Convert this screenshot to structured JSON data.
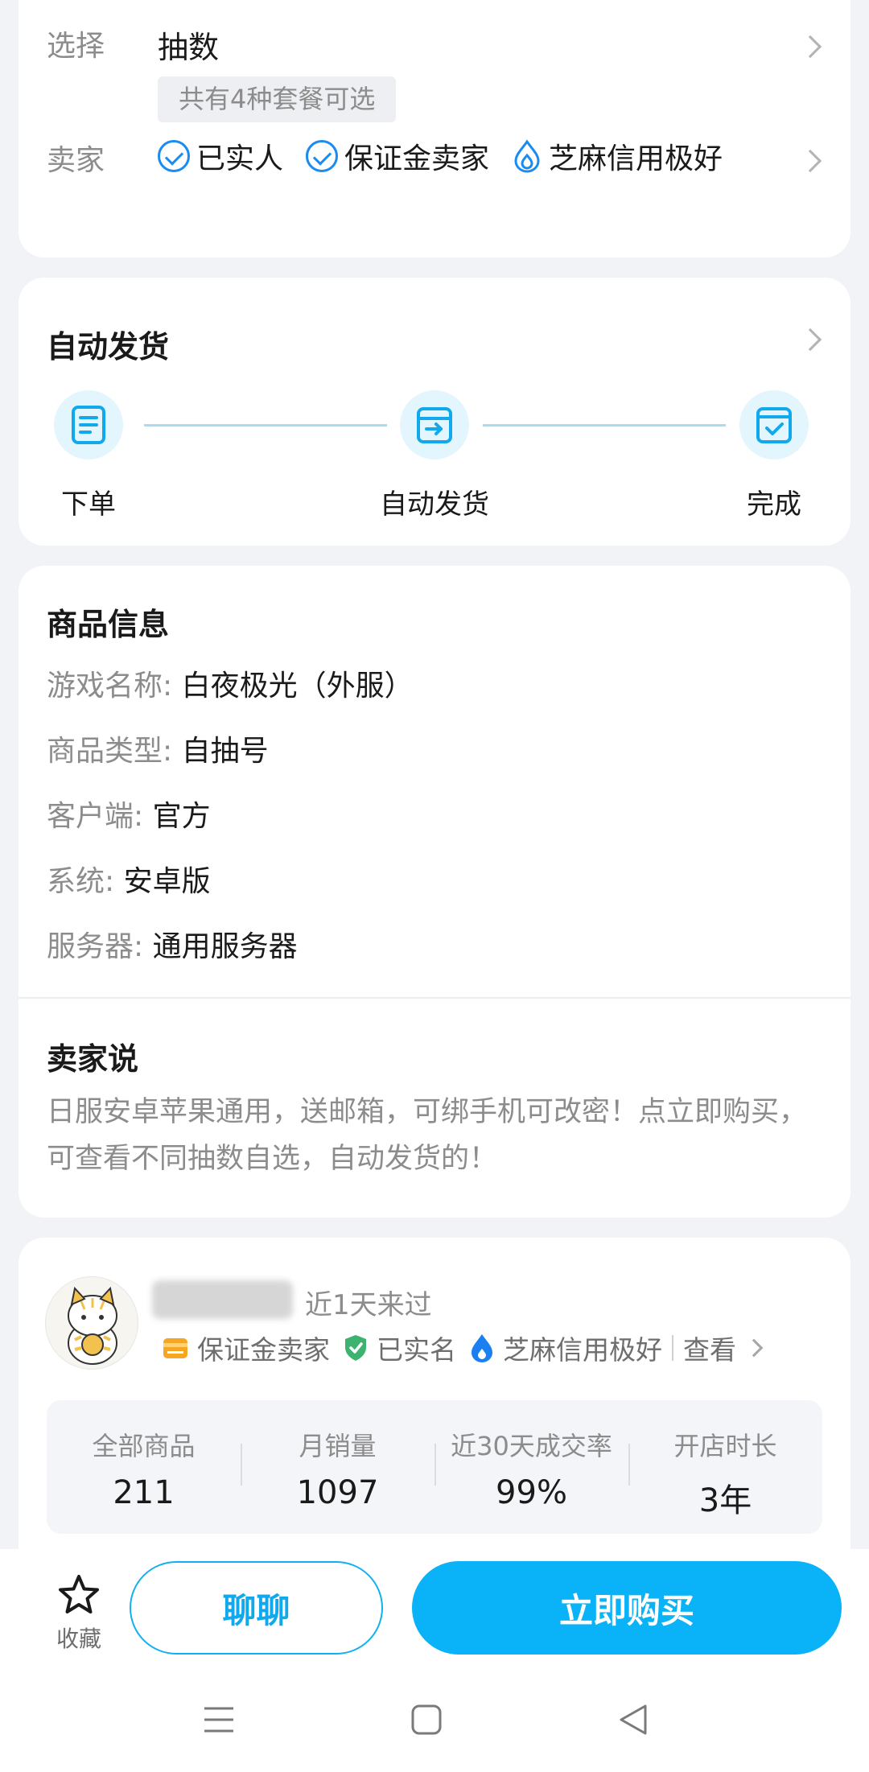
{
  "select_section": {
    "label": "选择",
    "value": "抽数",
    "package_chip": "共有4种套餐可选"
  },
  "seller_section": {
    "label": "卖家",
    "badges": [
      "已实人",
      "保证金卖家",
      "芝麻信用极好"
    ]
  },
  "delivery": {
    "title": "自动发货",
    "steps": [
      "下单",
      "自动发货",
      "完成"
    ]
  },
  "product_info": {
    "title": "商品信息",
    "rows": [
      {
        "key": "游戏名称:",
        "value": "白夜极光（外服）"
      },
      {
        "key": "商品类型:",
        "value": "自抽号"
      },
      {
        "key": "客户端:",
        "value": "官方"
      },
      {
        "key": "系统:",
        "value": "安卓版"
      },
      {
        "key": "服务器:",
        "value": "通用服务器"
      }
    ]
  },
  "seller_says": {
    "title": "卖家说",
    "text": "日服安卓苹果通用，送邮箱，可绑手机可改密！点立即购买，可查看不同抽数自选，自动发货的！"
  },
  "shop": {
    "last_visit": "近1天来过",
    "badges": [
      "保证金卖家",
      "已实名",
      "芝麻信用极好"
    ],
    "view_label": "查看",
    "stats": [
      {
        "label": "全部商品",
        "value": "211"
      },
      {
        "label": "月销量",
        "value": "1097"
      },
      {
        "label": "近30天成交率",
        "value": "99%"
      },
      {
        "label": "开店时长",
        "value": "3年"
      }
    ]
  },
  "bottom_bar": {
    "favorite_label": "收藏",
    "chat_label": "聊聊",
    "buy_label": "立即购买"
  },
  "colors": {
    "accent": "#0ab3f7",
    "verify_blue": "#1a8cf0",
    "deposit_orange": "#f5a623",
    "realname_green": "#3cb371"
  }
}
